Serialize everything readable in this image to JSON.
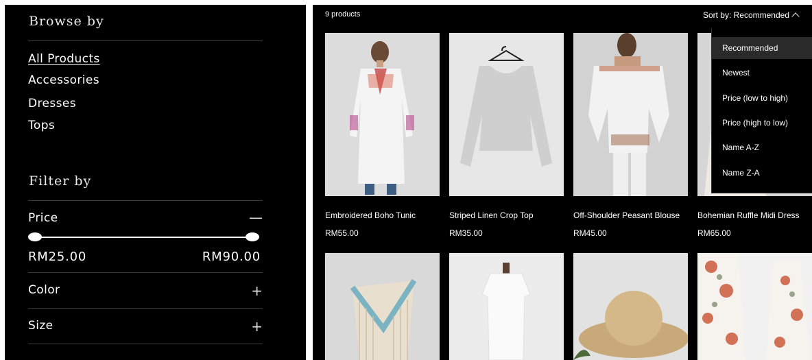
{
  "sidebar": {
    "browse_title": "Browse by",
    "categories": [
      "All Products",
      "Accessories",
      "Dresses",
      "Tops"
    ],
    "filter_title": "Filter by",
    "price": {
      "label": "Price",
      "min": "RM25.00",
      "max": "RM90.00",
      "toggle": "—"
    },
    "color": {
      "label": "Color",
      "toggle": "+"
    },
    "size": {
      "label": "Size",
      "toggle": "+"
    }
  },
  "main": {
    "count": "9 products",
    "sort_label": "Sort by: Recommended",
    "sort_options": [
      "Recommended",
      "Newest",
      "Price (low to high)",
      "Price (high to low)",
      "Name A-Z",
      "Name Z-A"
    ],
    "products": [
      {
        "name": "Embroidered Boho Tunic",
        "price": "RM55.00"
      },
      {
        "name": "Striped Linen Crop Top",
        "price": "RM35.00"
      },
      {
        "name": "Off-Shoulder Peasant Blouse",
        "price": "RM45.00"
      },
      {
        "name": "Bohemian Ruffle Midi Dress",
        "price": "RM65.00"
      }
    ]
  },
  "colors": {
    "background": "#000000",
    "text": "#ffffff",
    "selected": "#2a2a2a"
  }
}
